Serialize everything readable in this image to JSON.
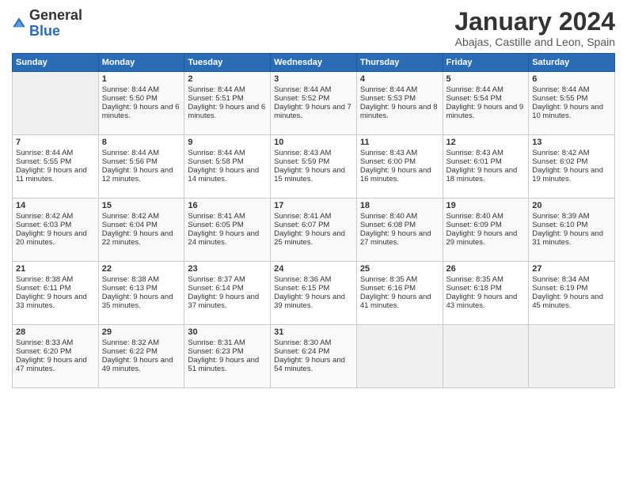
{
  "logo": {
    "general": "General",
    "blue": "Blue"
  },
  "header": {
    "month": "January 2024",
    "location": "Abajas, Castille and Leon, Spain"
  },
  "days_of_week": [
    "Sunday",
    "Monday",
    "Tuesday",
    "Wednesday",
    "Thursday",
    "Friday",
    "Saturday"
  ],
  "weeks": [
    [
      {
        "day": "",
        "sunrise": "",
        "sunset": "",
        "daylight": ""
      },
      {
        "day": "1",
        "sunrise": "Sunrise: 8:44 AM",
        "sunset": "Sunset: 5:50 PM",
        "daylight": "Daylight: 9 hours and 6 minutes."
      },
      {
        "day": "2",
        "sunrise": "Sunrise: 8:44 AM",
        "sunset": "Sunset: 5:51 PM",
        "daylight": "Daylight: 9 hours and 6 minutes."
      },
      {
        "day": "3",
        "sunrise": "Sunrise: 8:44 AM",
        "sunset": "Sunset: 5:52 PM",
        "daylight": "Daylight: 9 hours and 7 minutes."
      },
      {
        "day": "4",
        "sunrise": "Sunrise: 8:44 AM",
        "sunset": "Sunset: 5:53 PM",
        "daylight": "Daylight: 9 hours and 8 minutes."
      },
      {
        "day": "5",
        "sunrise": "Sunrise: 8:44 AM",
        "sunset": "Sunset: 5:54 PM",
        "daylight": "Daylight: 9 hours and 9 minutes."
      },
      {
        "day": "6",
        "sunrise": "Sunrise: 8:44 AM",
        "sunset": "Sunset: 5:55 PM",
        "daylight": "Daylight: 9 hours and 10 minutes."
      }
    ],
    [
      {
        "day": "7",
        "sunrise": "Sunrise: 8:44 AM",
        "sunset": "Sunset: 5:55 PM",
        "daylight": "Daylight: 9 hours and 11 minutes."
      },
      {
        "day": "8",
        "sunrise": "Sunrise: 8:44 AM",
        "sunset": "Sunset: 5:56 PM",
        "daylight": "Daylight: 9 hours and 12 minutes."
      },
      {
        "day": "9",
        "sunrise": "Sunrise: 8:44 AM",
        "sunset": "Sunset: 5:58 PM",
        "daylight": "Daylight: 9 hours and 14 minutes."
      },
      {
        "day": "10",
        "sunrise": "Sunrise: 8:43 AM",
        "sunset": "Sunset: 5:59 PM",
        "daylight": "Daylight: 9 hours and 15 minutes."
      },
      {
        "day": "11",
        "sunrise": "Sunrise: 8:43 AM",
        "sunset": "Sunset: 6:00 PM",
        "daylight": "Daylight: 9 hours and 16 minutes."
      },
      {
        "day": "12",
        "sunrise": "Sunrise: 8:43 AM",
        "sunset": "Sunset: 6:01 PM",
        "daylight": "Daylight: 9 hours and 18 minutes."
      },
      {
        "day": "13",
        "sunrise": "Sunrise: 8:42 AM",
        "sunset": "Sunset: 6:02 PM",
        "daylight": "Daylight: 9 hours and 19 minutes."
      }
    ],
    [
      {
        "day": "14",
        "sunrise": "Sunrise: 8:42 AM",
        "sunset": "Sunset: 6:03 PM",
        "daylight": "Daylight: 9 hours and 20 minutes."
      },
      {
        "day": "15",
        "sunrise": "Sunrise: 8:42 AM",
        "sunset": "Sunset: 6:04 PM",
        "daylight": "Daylight: 9 hours and 22 minutes."
      },
      {
        "day": "16",
        "sunrise": "Sunrise: 8:41 AM",
        "sunset": "Sunset: 6:05 PM",
        "daylight": "Daylight: 9 hours and 24 minutes."
      },
      {
        "day": "17",
        "sunrise": "Sunrise: 8:41 AM",
        "sunset": "Sunset: 6:07 PM",
        "daylight": "Daylight: 9 hours and 25 minutes."
      },
      {
        "day": "18",
        "sunrise": "Sunrise: 8:40 AM",
        "sunset": "Sunset: 6:08 PM",
        "daylight": "Daylight: 9 hours and 27 minutes."
      },
      {
        "day": "19",
        "sunrise": "Sunrise: 8:40 AM",
        "sunset": "Sunset: 6:09 PM",
        "daylight": "Daylight: 9 hours and 29 minutes."
      },
      {
        "day": "20",
        "sunrise": "Sunrise: 8:39 AM",
        "sunset": "Sunset: 6:10 PM",
        "daylight": "Daylight: 9 hours and 31 minutes."
      }
    ],
    [
      {
        "day": "21",
        "sunrise": "Sunrise: 8:38 AM",
        "sunset": "Sunset: 6:11 PM",
        "daylight": "Daylight: 9 hours and 33 minutes."
      },
      {
        "day": "22",
        "sunrise": "Sunrise: 8:38 AM",
        "sunset": "Sunset: 6:13 PM",
        "daylight": "Daylight: 9 hours and 35 minutes."
      },
      {
        "day": "23",
        "sunrise": "Sunrise: 8:37 AM",
        "sunset": "Sunset: 6:14 PM",
        "daylight": "Daylight: 9 hours and 37 minutes."
      },
      {
        "day": "24",
        "sunrise": "Sunrise: 8:36 AM",
        "sunset": "Sunset: 6:15 PM",
        "daylight": "Daylight: 9 hours and 39 minutes."
      },
      {
        "day": "25",
        "sunrise": "Sunrise: 8:35 AM",
        "sunset": "Sunset: 6:16 PM",
        "daylight": "Daylight: 9 hours and 41 minutes."
      },
      {
        "day": "26",
        "sunrise": "Sunrise: 8:35 AM",
        "sunset": "Sunset: 6:18 PM",
        "daylight": "Daylight: 9 hours and 43 minutes."
      },
      {
        "day": "27",
        "sunrise": "Sunrise: 8:34 AM",
        "sunset": "Sunset: 6:19 PM",
        "daylight": "Daylight: 9 hours and 45 minutes."
      }
    ],
    [
      {
        "day": "28",
        "sunrise": "Sunrise: 8:33 AM",
        "sunset": "Sunset: 6:20 PM",
        "daylight": "Daylight: 9 hours and 47 minutes."
      },
      {
        "day": "29",
        "sunrise": "Sunrise: 8:32 AM",
        "sunset": "Sunset: 6:22 PM",
        "daylight": "Daylight: 9 hours and 49 minutes."
      },
      {
        "day": "30",
        "sunrise": "Sunrise: 8:31 AM",
        "sunset": "Sunset: 6:23 PM",
        "daylight": "Daylight: 9 hours and 51 minutes."
      },
      {
        "day": "31",
        "sunrise": "Sunrise: 8:30 AM",
        "sunset": "Sunset: 6:24 PM",
        "daylight": "Daylight: 9 hours and 54 minutes."
      },
      {
        "day": "",
        "sunrise": "",
        "sunset": "",
        "daylight": ""
      },
      {
        "day": "",
        "sunrise": "",
        "sunset": "",
        "daylight": ""
      },
      {
        "day": "",
        "sunrise": "",
        "sunset": "",
        "daylight": ""
      }
    ]
  ]
}
